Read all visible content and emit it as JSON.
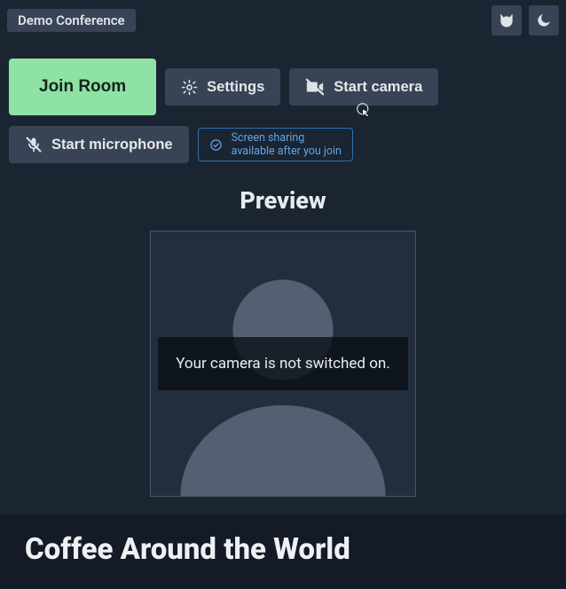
{
  "header": {
    "title": "Demo Conference"
  },
  "buttons": {
    "join": "Join Room",
    "settings": "Settings",
    "start_camera": "Start camera",
    "start_microphone": "Start microphone"
  },
  "notice": {
    "line1": "Screen sharing",
    "line2": "available after you join"
  },
  "preview": {
    "heading": "Preview",
    "overlay": "Your camera is not switched on."
  },
  "footer": {
    "title": "Coffee Around the World"
  }
}
